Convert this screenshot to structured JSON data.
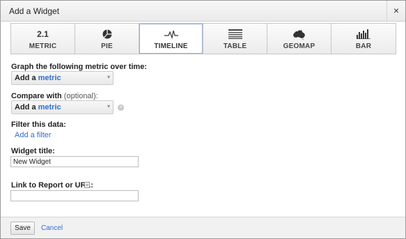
{
  "dialog": {
    "title": "Add a Widget",
    "close_label": "×"
  },
  "tabs": [
    {
      "label": "METRIC",
      "icon": "2.1",
      "icon_name": "metric-icon",
      "selected": false
    },
    {
      "label": "PIE",
      "icon_name": "pie-chart-icon",
      "selected": false
    },
    {
      "label": "TIMELINE",
      "icon_name": "timeline-icon",
      "selected": true
    },
    {
      "label": "TABLE",
      "icon_name": "table-icon",
      "selected": false
    },
    {
      "label": "GEOMAP",
      "icon_name": "australia-map-icon",
      "selected": false
    },
    {
      "label": "BAR",
      "icon_name": "bar-chart-icon",
      "selected": false
    }
  ],
  "graph_metric": {
    "label": "Graph the following metric over time:",
    "select_prefix": "Add a",
    "select_metric": "metric"
  },
  "compare": {
    "label": "Compare with",
    "optional": "(optional):",
    "select_prefix": "Add a",
    "select_metric": "metric"
  },
  "filter": {
    "label": "Filter this data:",
    "link": "Add a filter"
  },
  "widget_title": {
    "label": "Widget title:",
    "value": "New Widget"
  },
  "link_report": {
    "label": "Link to Report or URL:",
    "value": ""
  },
  "footer": {
    "save_label": "Save",
    "cancel_label": "Cancel"
  },
  "colors": {
    "link": "#2c6fd6",
    "selected_tab_border": "#9cb0d4"
  }
}
